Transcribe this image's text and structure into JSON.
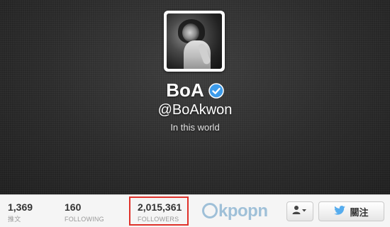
{
  "profile": {
    "name": "BoA",
    "handle": "@BoAkwon",
    "bio": "In this world",
    "verified": true
  },
  "stats": [
    {
      "value": "1,369",
      "label": "推文"
    },
    {
      "value": "160",
      "label": "FOLLOWING"
    },
    {
      "value": "2,015,361",
      "label": "FOLLOWERS"
    }
  ],
  "watermark": "kpopn",
  "buttons": {
    "follow_label": "關注",
    "user_menu_icon": "user-dropdown-icon",
    "follow_icon": "twitter-bird-icon"
  },
  "colors": {
    "verified_blue": "#3d9be9",
    "twitter_blue": "#55acee",
    "highlight_red": "#e0312a"
  }
}
